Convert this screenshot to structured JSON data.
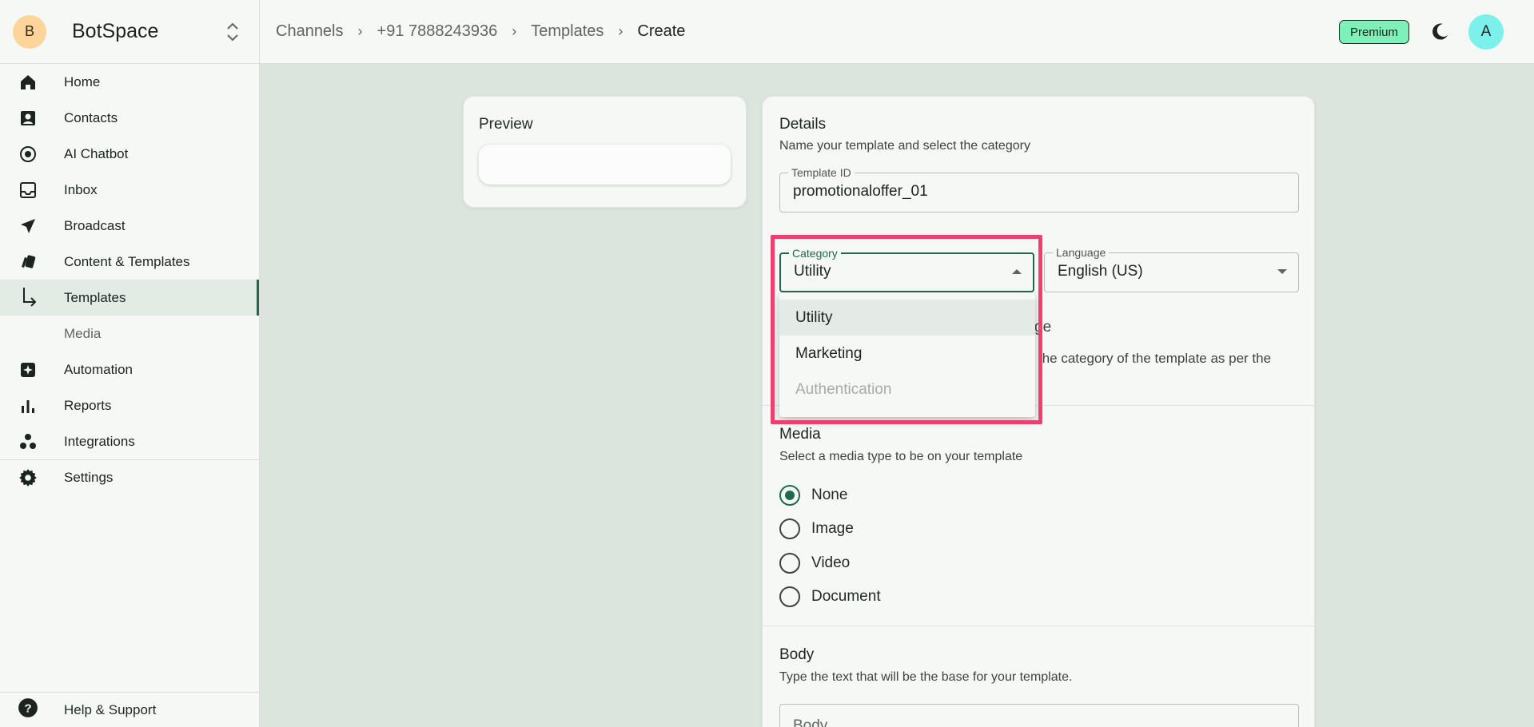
{
  "brand": {
    "initial": "B",
    "name": "BotSpace"
  },
  "sidebar": {
    "items": [
      {
        "label": "Home",
        "icon": "home-icon"
      },
      {
        "label": "Contacts",
        "icon": "contacts-icon"
      },
      {
        "label": "AI Chatbot",
        "icon": "ai-chatbot-icon"
      },
      {
        "label": "Inbox",
        "icon": "inbox-icon"
      },
      {
        "label": "Broadcast",
        "icon": "send-icon"
      },
      {
        "label": "Content & Templates",
        "icon": "cards-icon"
      },
      {
        "label": "Templates",
        "icon": "subitem-arrow-icon",
        "active": true
      },
      {
        "label": "Media"
      },
      {
        "label": "Automation",
        "icon": "sparkle-icon"
      },
      {
        "label": "Reports",
        "icon": "bar-chart-icon"
      },
      {
        "label": "Integrations",
        "icon": "integrations-icon"
      },
      {
        "label": "Settings",
        "icon": "gear-icon"
      }
    ],
    "help": "Help & Support"
  },
  "breadcrumb": [
    "Channels",
    "+91 7888243936",
    "Templates",
    "Create"
  ],
  "header": {
    "premium": "Premium",
    "user_initial": "A"
  },
  "preview": {
    "title": "Preview"
  },
  "details": {
    "title": "Details",
    "description": "Name your template and select the category",
    "template_id": {
      "label": "Template ID",
      "value": "promotionaloffer_01"
    },
    "category": {
      "label": "Category",
      "value": "Utility",
      "options": [
        "Utility",
        "Marketing",
        "Authentication"
      ]
    },
    "language": {
      "label": "Language",
      "value": "English (US)"
    },
    "hidden_partial_1": "ge",
    "hidden_partial_2": "the category of the template as per the"
  },
  "media": {
    "title": "Media",
    "description": "Select a media type to be on your template",
    "options": [
      "None",
      "Image",
      "Video",
      "Document"
    ],
    "selected": "None"
  },
  "body": {
    "title": "Body",
    "description": "Type the text that will be the base for your template.",
    "placeholder": "Body"
  },
  "colors": {
    "accent": "#1f6a4d",
    "highlight": "#ee3f6e",
    "premium": "#7ef1b8"
  }
}
